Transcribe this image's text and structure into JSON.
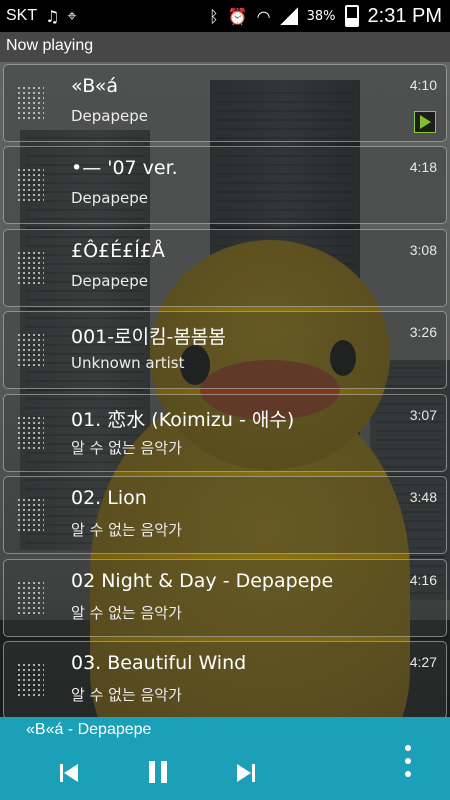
{
  "status_bar": {
    "carrier": "SKT",
    "battery": "38%",
    "time": "2:31 PM"
  },
  "header": {
    "title": "Now playing"
  },
  "tracks": [
    {
      "title": "«B«á",
      "artist": "Depapepe",
      "duration": "4:10",
      "playing": true
    },
    {
      "title": "•— '07 ver.",
      "artist": "Depapepe",
      "duration": "4:18"
    },
    {
      "title": "£Ô£É£Í£Å",
      "artist": "Depapepe",
      "duration": "3:08"
    },
    {
      "title": "001-로이킴-봄봄봄",
      "artist": "Unknown artist",
      "duration": "3:26"
    },
    {
      "title": "01. 恋水 (Koimizu - 애수)",
      "artist": "알 수 없는 음악가",
      "duration": "3:07"
    },
    {
      "title": "02. Lion",
      "artist": "알 수 없는 음악가",
      "duration": "3:48"
    },
    {
      "title": "02 Night & Day - Depapepe",
      "artist": "알 수 없는 음악가",
      "duration": "4:16"
    },
    {
      "title": "03. Beautiful Wind",
      "artist": "알 수 없는 음악가",
      "duration": "4:27"
    }
  ],
  "player": {
    "now_playing": "«B«á - Depapepe",
    "accent_color": "#1ba0b8"
  },
  "icons": [
    "music-note-icon",
    "location-icon",
    "bluetooth-icon",
    "alarm-icon",
    "wifi-icon",
    "signal-icon",
    "battery-icon",
    "drag-handle-icon",
    "now-playing-icon",
    "previous-icon",
    "pause-icon",
    "next-icon",
    "overflow-menu-icon"
  ]
}
